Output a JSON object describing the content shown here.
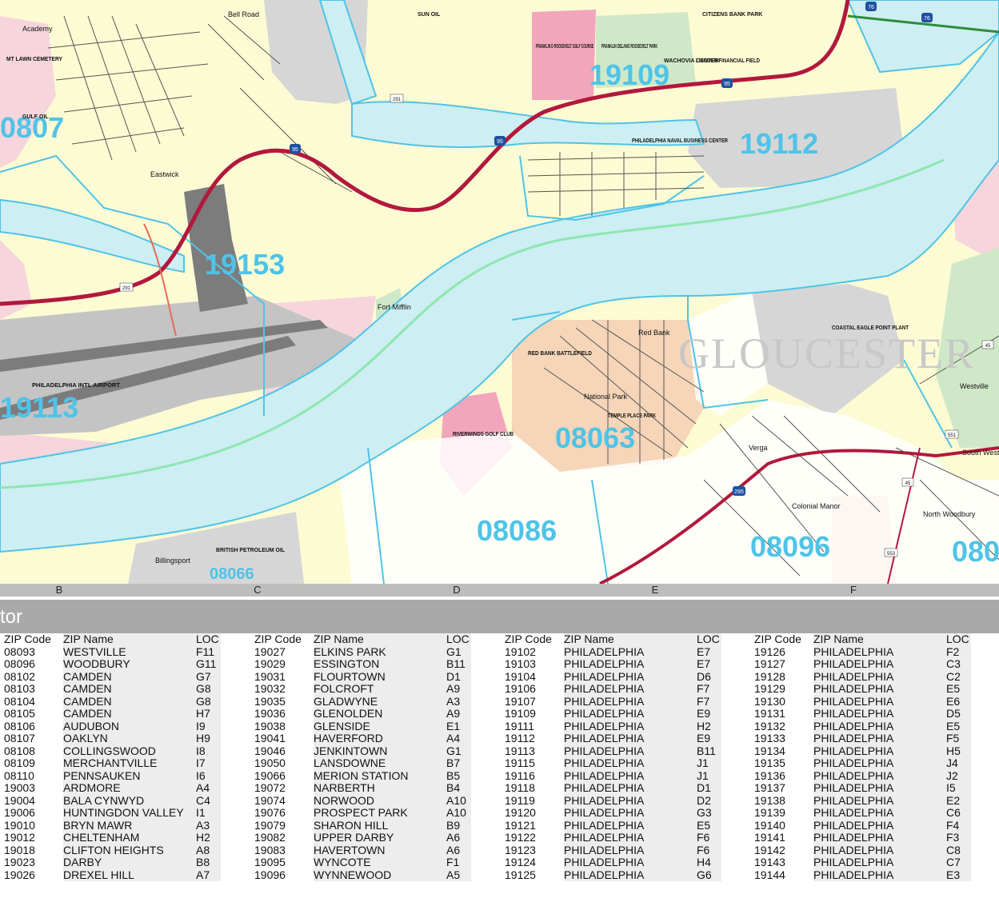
{
  "map": {
    "zip_labels": [
      "19153",
      "19113",
      "19112",
      "19109",
      "08063",
      "08086",
      "08096",
      "08066",
      "0807",
      "080"
    ],
    "region_label": "GLOUCESTER",
    "places": [
      "Academy",
      "Bell Road",
      "SUN OIL",
      "Eastwick",
      "Fort Mifflin",
      "Red Bank",
      "National Park",
      "Verga",
      "Colonial Manor",
      "North Woodbury",
      "Westville",
      "South West",
      "Billingsport"
    ],
    "facilities": [
      "FRANKLIN D ROOSEVELT GOLF COURSE",
      "FRANKLIN DELANO ROOSEVELT PARK",
      "WACHOVIA CENTER",
      "CITIZENS BANK PARK",
      "LINCOLN FINANCIAL FIELD",
      "PHILADELPHIA NAVAL BUSINESS CENTER",
      "PHILADELPHIA INTL AIRPORT",
      "RIVERWINDS GOLF CLUB",
      "COASTAL EAGLE POINT PLANT",
      "BRITISH PETROLEUM OIL",
      "RED BANK BATTLEFIELD",
      "TEMPLE PLACE PARK",
      "MT LAWN CEMETERY",
      "GULF OIL"
    ],
    "highway_shields": [
      "95",
      "95",
      "95",
      "291",
      "291",
      "76",
      "76",
      "295",
      "45",
      "45",
      "551",
      "553"
    ]
  },
  "grid": {
    "columns": [
      "B",
      "C",
      "D",
      "E",
      "F"
    ]
  },
  "index": {
    "title": "tor",
    "headers": {
      "code": "ZIP Code",
      "name": "ZIP Name",
      "loc": "LOC"
    },
    "columns": [
      [
        [
          "08093",
          "WESTVILLE",
          "F11"
        ],
        [
          "08096",
          "WOODBURY",
          "G11"
        ],
        [
          "08102",
          "CAMDEN",
          "G7"
        ],
        [
          "08103",
          "CAMDEN",
          "G8"
        ],
        [
          "08104",
          "CAMDEN",
          "G8"
        ],
        [
          "08105",
          "CAMDEN",
          "H7"
        ],
        [
          "08106",
          "AUDUBON",
          "I9"
        ],
        [
          "08107",
          "OAKLYN",
          "H9"
        ],
        [
          "08108",
          "COLLINGSWOOD",
          "I8"
        ],
        [
          "08109",
          "MERCHANTVILLE",
          "I7"
        ],
        [
          "08110",
          "PENNSAUKEN",
          "I6"
        ],
        [
          "19003",
          "ARDMORE",
          "A4"
        ],
        [
          "19004",
          "BALA CYNWYD",
          "C4"
        ],
        [
          "19006",
          "HUNTINGDON VALLEY",
          "I1"
        ],
        [
          "19010",
          "BRYN MAWR",
          "A3"
        ],
        [
          "19012",
          "CHELTENHAM",
          "H2"
        ],
        [
          "19018",
          "CLIFTON HEIGHTS",
          "A8"
        ],
        [
          "19023",
          "DARBY",
          "B8"
        ],
        [
          "19026",
          "DREXEL HILL",
          "A7"
        ]
      ],
      [
        [
          "19027",
          "ELKINS PARK",
          "G1"
        ],
        [
          "19029",
          "ESSINGTON",
          "B11"
        ],
        [
          "19031",
          "FLOURTOWN",
          "D1"
        ],
        [
          "19032",
          "FOLCROFT",
          "A9"
        ],
        [
          "19035",
          "GLADWYNE",
          "A3"
        ],
        [
          "19036",
          "GLENOLDEN",
          "A9"
        ],
        [
          "19038",
          "GLENSIDE",
          "E1"
        ],
        [
          "19041",
          "HAVERFORD",
          "A4"
        ],
        [
          "19046",
          "JENKINTOWN",
          "G1"
        ],
        [
          "19050",
          "LANSDOWNE",
          "B7"
        ],
        [
          "19066",
          "MERION STATION",
          "B5"
        ],
        [
          "19072",
          "NARBERTH",
          "B4"
        ],
        [
          "19074",
          "NORWOOD",
          "A10"
        ],
        [
          "19076",
          "PROSPECT PARK",
          "A10"
        ],
        [
          "19079",
          "SHARON HILL",
          "B9"
        ],
        [
          "19082",
          "UPPER DARBY",
          "A6"
        ],
        [
          "19083",
          "HAVERTOWN",
          "A6"
        ],
        [
          "19095",
          "WYNCOTE",
          "F1"
        ],
        [
          "19096",
          "WYNNEWOOD",
          "A5"
        ]
      ],
      [
        [
          "19102",
          "PHILADELPHIA",
          "E7"
        ],
        [
          "19103",
          "PHILADELPHIA",
          "E7"
        ],
        [
          "19104",
          "PHILADELPHIA",
          "D6"
        ],
        [
          "19106",
          "PHILADELPHIA",
          "F7"
        ],
        [
          "19107",
          "PHILADELPHIA",
          "F7"
        ],
        [
          "19109",
          "PHILADELPHIA",
          "E9"
        ],
        [
          "19111",
          "PHILADELPHIA",
          "H2"
        ],
        [
          "19112",
          "PHILADELPHIA",
          "E9"
        ],
        [
          "19113",
          "PHILADELPHIA",
          "B11"
        ],
        [
          "19115",
          "PHILADELPHIA",
          "J1"
        ],
        [
          "19116",
          "PHILADELPHIA",
          "J1"
        ],
        [
          "19118",
          "PHILADELPHIA",
          "D1"
        ],
        [
          "19119",
          "PHILADELPHIA",
          "D2"
        ],
        [
          "19120",
          "PHILADELPHIA",
          "G3"
        ],
        [
          "19121",
          "PHILADELPHIA",
          "E5"
        ],
        [
          "19122",
          "PHILADELPHIA",
          "F6"
        ],
        [
          "19123",
          "PHILADELPHIA",
          "F6"
        ],
        [
          "19124",
          "PHILADELPHIA",
          "H4"
        ],
        [
          "19125",
          "PHILADELPHIA",
          "G6"
        ]
      ],
      [
        [
          "19126",
          "PHILADELPHIA",
          "F2"
        ],
        [
          "19127",
          "PHILADELPHIA",
          "C3"
        ],
        [
          "19128",
          "PHILADELPHIA",
          "C2"
        ],
        [
          "19129",
          "PHILADELPHIA",
          "E5"
        ],
        [
          "19130",
          "PHILADELPHIA",
          "E6"
        ],
        [
          "19131",
          "PHILADELPHIA",
          "D5"
        ],
        [
          "19132",
          "PHILADELPHIA",
          "E5"
        ],
        [
          "19133",
          "PHILADELPHIA",
          "F5"
        ],
        [
          "19134",
          "PHILADELPHIA",
          "H5"
        ],
        [
          "19135",
          "PHILADELPHIA",
          "J4"
        ],
        [
          "19136",
          "PHILADELPHIA",
          "J2"
        ],
        [
          "19137",
          "PHILADELPHIA",
          "I5"
        ],
        [
          "19138",
          "PHILADELPHIA",
          "E2"
        ],
        [
          "19139",
          "PHILADELPHIA",
          "C6"
        ],
        [
          "19140",
          "PHILADELPHIA",
          "F4"
        ],
        [
          "19141",
          "PHILADELPHIA",
          "F3"
        ],
        [
          "19142",
          "PHILADELPHIA",
          "C8"
        ],
        [
          "19143",
          "PHILADELPHIA",
          "C7"
        ],
        [
          "19144",
          "PHILADELPHIA",
          "E3"
        ]
      ]
    ]
  }
}
